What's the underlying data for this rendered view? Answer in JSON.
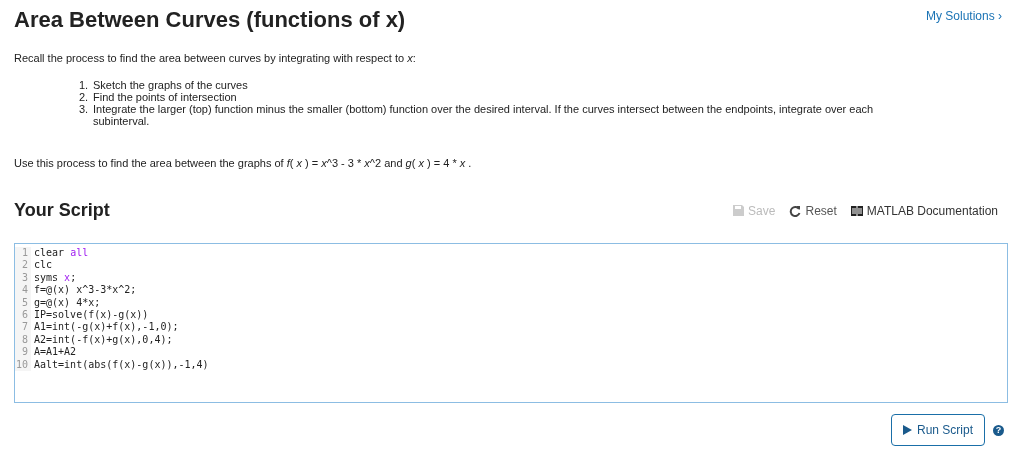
{
  "header": {
    "title": "Area Between Curves (functions of x)",
    "link": "My Solutions",
    "link_icon": "›"
  },
  "intro": [
    {
      "text": "Recall the process to find the area between curves by integrating with respect to ",
      "italic": false
    },
    {
      "text": "x",
      "italic": true
    },
    {
      "text": ":",
      "italic": false
    }
  ],
  "steps": [
    {
      "number": "1.",
      "text": "Sketch the graphs of the curves"
    },
    {
      "number": "2.",
      "text": "Find the points of intersection"
    },
    {
      "number": "3.",
      "text": "Integrate the larger (top) function minus the smaller (bottom) function over the desired interval. If the curves intersect between the endpoints, integrate over each subinterval."
    }
  ],
  "task": [
    {
      "text": "Use this process to find the area between the graphs of ",
      "italic": false
    },
    {
      "text": "f",
      "italic": true
    },
    {
      "text": "( ",
      "italic": false
    },
    {
      "text": "x",
      "italic": true
    },
    {
      "text": " ) = ",
      "italic": false
    },
    {
      "text": "x",
      "italic": true
    },
    {
      "text": "^3 - 3 * ",
      "italic": false
    },
    {
      "text": "x",
      "italic": true
    },
    {
      "text": "^2 and ",
      "italic": false
    },
    {
      "text": "g",
      "italic": true
    },
    {
      "text": "( ",
      "italic": false
    },
    {
      "text": "x",
      "italic": true
    },
    {
      "text": " ) = 4 * ",
      "italic": false
    },
    {
      "text": "x",
      "italic": true
    },
    {
      "text": " .",
      "italic": false
    }
  ],
  "script": {
    "heading": "Your Script",
    "toolbar": [
      {
        "kind": "save",
        "label": "Save",
        "disabled": true
      },
      {
        "kind": "reset",
        "label": "Reset",
        "disabled": false
      },
      {
        "kind": "docs",
        "label": "MATLAB Documentation",
        "disabled": false
      }
    ],
    "lines": [
      {
        "number": "1",
        "tokens": [
          {
            "text": "clear ",
            "kind": "plain"
          },
          {
            "text": "all",
            "kind": "keyword"
          }
        ]
      },
      {
        "number": "2",
        "tokens": [
          {
            "text": "clc",
            "kind": "plain"
          }
        ]
      },
      {
        "number": "3",
        "tokens": [
          {
            "text": "syms ",
            "kind": "plain"
          },
          {
            "text": "x",
            "kind": "keyword"
          },
          {
            "text": ";",
            "kind": "plain"
          }
        ]
      },
      {
        "number": "4",
        "tokens": [
          {
            "text": "f=@(x) x^3-3*x^2;",
            "kind": "plain"
          }
        ]
      },
      {
        "number": "5",
        "tokens": [
          {
            "text": "g=@(x) 4*x;",
            "kind": "plain"
          }
        ]
      },
      {
        "number": "6",
        "tokens": [
          {
            "text": "IP=solve(f(x)-g(x))",
            "kind": "plain"
          }
        ]
      },
      {
        "number": "7",
        "tokens": [
          {
            "text": "A1=int(-g(x)+f(x),-1,0);",
            "kind": "plain"
          }
        ]
      },
      {
        "number": "8",
        "tokens": [
          {
            "text": "A2=int(-f(x)+g(x),0,4);",
            "kind": "plain"
          }
        ]
      },
      {
        "number": "9",
        "tokens": [
          {
            "text": "A=A1+A2",
            "kind": "plain"
          }
        ]
      },
      {
        "number": "10",
        "tokens": [
          {
            "text": "Aalt=int(abs(f(x)-g(x)),-1,4)",
            "kind": "plain"
          }
        ]
      }
    ],
    "run_button": "Run Script",
    "help_icon": "?"
  }
}
